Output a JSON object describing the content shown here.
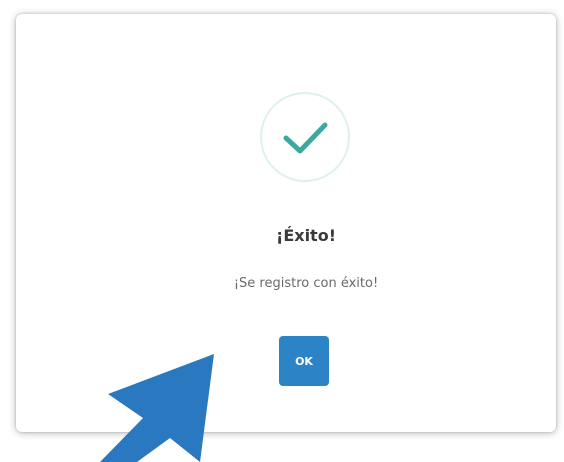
{
  "dialog": {
    "title": "¡Éxito!",
    "message": "¡Se registro con éxito!",
    "ok_label": "OK"
  },
  "icons": {
    "status": "check-icon",
    "pointer": "mouse-pointer-icon"
  },
  "colors": {
    "check": "#3aa9a0",
    "ring": "#dff1ee",
    "button": "#2c84c7",
    "pointer": "#2a78c0"
  }
}
